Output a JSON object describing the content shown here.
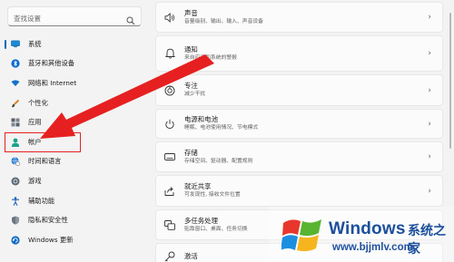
{
  "search": {
    "placeholder": "查找设置"
  },
  "sidebar": {
    "items": [
      {
        "label": "系统",
        "icon": "monitor-icon"
      },
      {
        "label": "蓝牙和其他设备",
        "icon": "bluetooth-icon"
      },
      {
        "label": "网络和 Internet",
        "icon": "wifi-icon"
      },
      {
        "label": "个性化",
        "icon": "brush-icon"
      },
      {
        "label": "应用",
        "icon": "apps-icon"
      },
      {
        "label": "帐户",
        "icon": "account-icon"
      },
      {
        "label": "时间和语言",
        "icon": "globe-clock-icon"
      },
      {
        "label": "游戏",
        "icon": "gamepad-icon"
      },
      {
        "label": "辅助功能",
        "icon": "accessibility-icon"
      },
      {
        "label": "隐私和安全性",
        "icon": "shield-icon"
      },
      {
        "label": "Windows 更新",
        "icon": "update-icon"
      }
    ],
    "active_index": 0,
    "highlighted_index": 5
  },
  "cards": [
    {
      "title": "声音",
      "subtitle": "音量级别、输出、输入、声音设备",
      "icon": "speaker-icon"
    },
    {
      "title": "通知",
      "subtitle": "来自应用和系统的警报",
      "icon": "bell-icon"
    },
    {
      "title": "专注",
      "subtitle": "减少干扰",
      "icon": "focus-icon"
    },
    {
      "title": "电源和电池",
      "subtitle": "睡眠、电池使用情况、节电模式",
      "icon": "power-icon"
    },
    {
      "title": "存储",
      "subtitle": "存储空间、驱动器、配置规则",
      "icon": "storage-icon"
    },
    {
      "title": "就近共享",
      "subtitle": "可发现性, 接收文件位置",
      "icon": "share-icon"
    },
    {
      "title": "多任务处理",
      "subtitle": "贴靠窗口、桌面、任务切换",
      "icon": "multitask-icon"
    },
    {
      "title": "激活",
      "subtitle": "",
      "icon": "key-icon"
    }
  ],
  "colors": {
    "accent": "#0067c0",
    "highlight_red": "#e62020",
    "watermark_blue": "#1c4f9c"
  },
  "watermark": {
    "brand": "Windows",
    "cn": "系统之家",
    "url": "www.bjjmlv.com"
  }
}
